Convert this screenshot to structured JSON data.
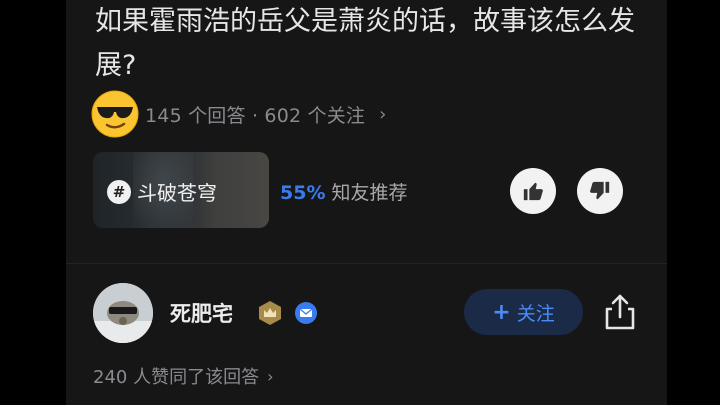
{
  "question": {
    "title": "如果霍雨浩的岳父是萧炎的话，故事该怎么发展?",
    "stats": "145 个回答 · 602 个关注"
  },
  "topic": {
    "name": "斗破苍穹"
  },
  "recommend": {
    "percent": "55%",
    "label": "知友推荐"
  },
  "answer": {
    "author": "死肥宅",
    "follow_label": "关注",
    "likes_text": "240 人赞同了该回答"
  },
  "icons": {
    "emoji": "cool-sunglasses-emoji",
    "vote_up": "thumbs-up-icon",
    "vote_down": "thumbs-down-icon",
    "share": "share-icon",
    "badge_level": "crown-badge-icon",
    "badge_verified": "mail-badge-icon"
  },
  "colors": {
    "accent": "#3a7cf0",
    "follow_bg": "#1a2a47",
    "background": "#161617"
  }
}
